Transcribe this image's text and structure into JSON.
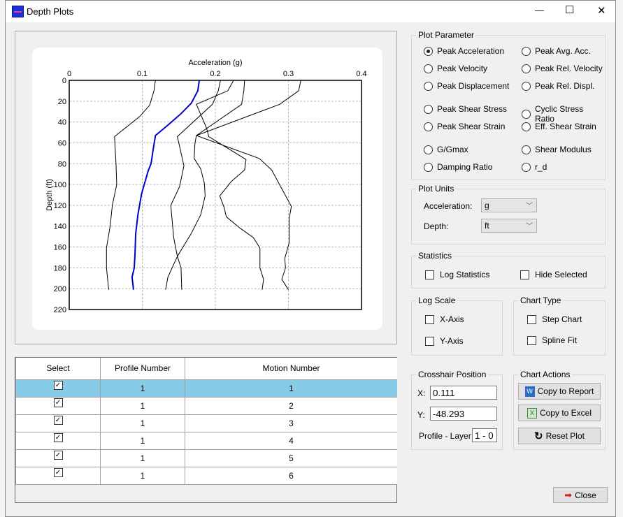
{
  "window": {
    "title": "Depth Plots",
    "minimize": "—",
    "maximize": "☐",
    "close": "✕"
  },
  "plot_parameter": {
    "title": "Plot Parameter",
    "selected": "Peak Acceleration",
    "options": [
      "Peak Acceleration",
      "Peak Avg. Acc.",
      "Peak Velocity",
      "Peak Rel. Velocity",
      "Peak Displacement",
      "Peak Rel. Displ.",
      "Peak Shear Stress",
      "Cyclic Stress Ratio",
      "Peak Shear Strain",
      "Eff. Shear Strain",
      "G/Gmax",
      "Shear Modulus",
      "Damping Ratio",
      "r_d"
    ]
  },
  "plot_units": {
    "title": "Plot Units",
    "acc_label": "Acceleration:",
    "acc_value": "g",
    "depth_label": "Depth:",
    "depth_value": "ft"
  },
  "statistics": {
    "title": "Statistics",
    "log_stats": "Log Statistics",
    "hide_selected": "Hide Selected",
    "log_stats_checked": false,
    "hide_selected_checked": false
  },
  "log_scale": {
    "title": "Log Scale",
    "x": "X-Axis",
    "y": "Y-Axis",
    "x_checked": false,
    "y_checked": false
  },
  "chart_type": {
    "title": "Chart Type",
    "step": "Step Chart",
    "spline": "Spline Fit",
    "step_checked": false,
    "spline_checked": false
  },
  "crosshair": {
    "title": "Crosshair Position",
    "x_label": "X:",
    "x_value": "0.111",
    "y_label": "Y:",
    "y_value": "-48.293",
    "pl_label": "Profile - Layer:",
    "pl_value": "1 - 0"
  },
  "chart_actions": {
    "title": "Chart Actions",
    "copy_report": "Copy to Report",
    "copy_excel": "Copy to Excel",
    "reset": "Reset Plot"
  },
  "close_button": "Close",
  "table": {
    "headers": [
      "Select",
      "Profile Number",
      "Motion Number"
    ],
    "rows": [
      {
        "select": true,
        "profile": "1",
        "motion": "1",
        "selected": true
      },
      {
        "select": true,
        "profile": "1",
        "motion": "2"
      },
      {
        "select": true,
        "profile": "1",
        "motion": "3"
      },
      {
        "select": true,
        "profile": "1",
        "motion": "4"
      },
      {
        "select": true,
        "profile": "1",
        "motion": "5"
      },
      {
        "select": true,
        "profile": "1",
        "motion": "6"
      }
    ]
  },
  "chart_data": {
    "type": "line",
    "xlabel": "Acceleration (g)",
    "ylabel": "Depth (ft)",
    "xlim": [
      0,
      0.4
    ],
    "ylim": [
      0,
      220
    ],
    "y_inverted": true,
    "x_axis_position": "top",
    "grid": true,
    "xticks": [
      "0",
      "0.1",
      "0.2",
      "0.3",
      "0.4"
    ],
    "yticks": [
      "0",
      "20",
      "40",
      "60",
      "80",
      "100",
      "120",
      "140",
      "160",
      "180",
      "200",
      "220"
    ],
    "colors": {
      "selected": "#0000cc",
      "default": "#000000"
    },
    "series": [
      {
        "motion": "1",
        "highlighted": true,
        "points": [
          [
            0.178,
            0
          ],
          [
            0.176,
            10
          ],
          [
            0.167,
            22
          ],
          [
            0.153,
            32
          ],
          [
            0.135,
            43
          ],
          [
            0.118,
            53
          ],
          [
            0.115,
            66
          ],
          [
            0.112,
            80
          ],
          [
            0.108,
            87
          ],
          [
            0.099,
            109
          ],
          [
            0.094,
            129
          ],
          [
            0.091,
            147
          ],
          [
            0.09,
            167
          ],
          [
            0.089,
            180
          ],
          [
            0.086,
            189
          ],
          [
            0.088,
            201
          ]
        ]
      },
      {
        "motion": "2",
        "points": [
          [
            0.118,
            0
          ],
          [
            0.116,
            10
          ],
          [
            0.11,
            24
          ],
          [
            0.096,
            35
          ],
          [
            0.062,
            54
          ],
          [
            0.064,
            80
          ],
          [
            0.065,
            100
          ],
          [
            0.059,
            120
          ],
          [
            0.056,
            140
          ],
          [
            0.051,
            161
          ],
          [
            0.051,
            180
          ],
          [
            0.054,
            201
          ]
        ]
      },
      {
        "motion": "3",
        "points": [
          [
            0.207,
            0
          ],
          [
            0.204,
            10
          ],
          [
            0.196,
            23
          ],
          [
            0.148,
            54
          ],
          [
            0.157,
            82
          ],
          [
            0.151,
            102
          ],
          [
            0.139,
            120
          ],
          [
            0.143,
            151
          ],
          [
            0.148,
            169
          ],
          [
            0.153,
            180
          ],
          [
            0.154,
            201
          ]
        ]
      },
      {
        "motion": "4",
        "points": [
          [
            0.225,
            0
          ],
          [
            0.217,
            10
          ],
          [
            0.174,
            23
          ],
          [
            0.188,
            46
          ],
          [
            0.191,
            54
          ],
          [
            0.242,
            76
          ],
          [
            0.24,
            86
          ],
          [
            0.222,
            97
          ],
          [
            0.206,
            111
          ],
          [
            0.212,
            122
          ],
          [
            0.215,
            131
          ],
          [
            0.234,
            142
          ],
          [
            0.252,
            151
          ],
          [
            0.261,
            161
          ],
          [
            0.261,
            180
          ],
          [
            0.266,
            191
          ],
          [
            0.264,
            201
          ]
        ]
      },
      {
        "motion": "5",
        "points": [
          [
            0.24,
            0
          ],
          [
            0.239,
            10
          ],
          [
            0.236,
            23
          ],
          [
            0.174,
            53
          ],
          [
            0.172,
            61
          ],
          [
            0.171,
            75
          ],
          [
            0.18,
            85
          ],
          [
            0.185,
            99
          ],
          [
            0.186,
            111
          ],
          [
            0.18,
            129
          ],
          [
            0.167,
            147
          ],
          [
            0.148,
            169
          ],
          [
            0.135,
            189
          ],
          [
            0.132,
            201
          ]
        ]
      },
      {
        "motion": "6",
        "points": [
          [
            0.317,
            0
          ],
          [
            0.314,
            10
          ],
          [
            0.288,
            23
          ],
          [
            0.174,
            53
          ],
          [
            0.26,
            75
          ],
          [
            0.277,
            86
          ],
          [
            0.304,
            121
          ],
          [
            0.301,
            133
          ],
          [
            0.301,
            156
          ],
          [
            0.295,
            171
          ],
          [
            0.296,
            180
          ],
          [
            0.291,
            191
          ],
          [
            0.3,
            201
          ]
        ]
      }
    ]
  }
}
